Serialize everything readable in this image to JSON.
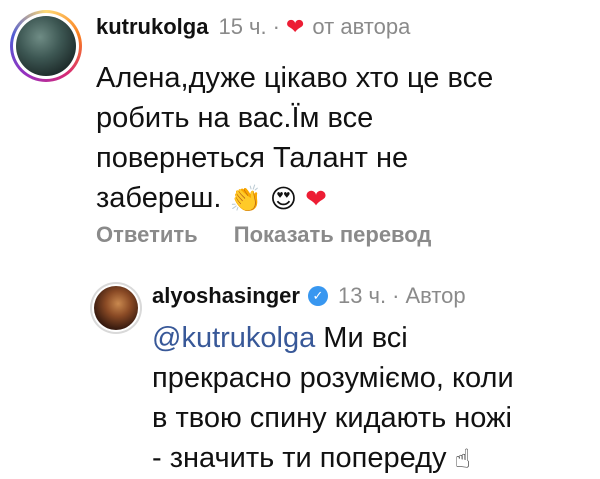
{
  "comment1": {
    "username": "kutrukolga",
    "time": "15 ч.",
    "separator": "·",
    "liked_by_author_label": "от автора",
    "text_lines": [
      "Алена,дуже цікаво хто це все",
      "робить на вас.Їм все",
      "повернеться Талант не",
      "забереш."
    ],
    "emojis": [
      "👏",
      "😍",
      "❤"
    ],
    "actions": {
      "reply": "Ответить",
      "translate": "Показать перевод"
    }
  },
  "comment2": {
    "username": "alyoshasinger",
    "verified": "✓",
    "time": "13 ч.",
    "separator": "·",
    "author_label": "Автор",
    "mention": "@kutrukolga",
    "text_first": " Ми всі",
    "text_lines": [
      "прекрасно розуміємо, коли",
      "в твою спину кидають ножі",
      "- значить ти попереду"
    ],
    "emoji": "☝"
  },
  "colors": {
    "heart": "#ed1d34",
    "verified": "#3897f0",
    "mention": "#385898",
    "muted": "#8a8a8a"
  }
}
